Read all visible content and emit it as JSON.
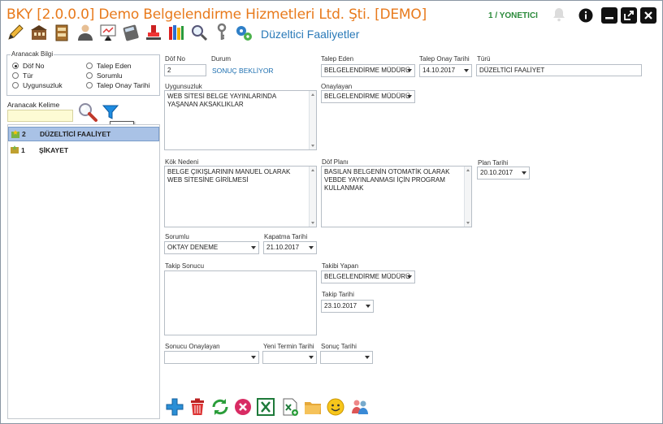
{
  "titlebar": {
    "app_title": "BKY [2.0.0.0] Demo Belgelendirme Hizmetleri Ltd. Şti. [DEMO]",
    "user": "1 / YONETICI",
    "module_title": "Düzeltici Faaliyetler"
  },
  "toolbar_icons": [
    "pencil-icon",
    "building-icon",
    "archive-icon",
    "user-icon",
    "presentation-icon",
    "calculator-icon",
    "stamp-icon",
    "books-icon",
    "magnifier-icon",
    "key-icon",
    "gears-icon"
  ],
  "left": {
    "group_title": "Aranacak Bilgi",
    "radios": [
      {
        "label": "Döf No",
        "checked": true
      },
      {
        "label": "Tür",
        "checked": false
      },
      {
        "label": "Uygunsuzluk",
        "checked": false
      },
      {
        "label": "Talep Eden",
        "checked": false
      },
      {
        "label": "Sorumlu",
        "checked": false
      },
      {
        "label": "Talep Onay Tarihi",
        "checked": false
      }
    ],
    "search_label": "Aranacak Kelime",
    "search_value": "",
    "tooltip": "Süz...",
    "list": [
      {
        "no": "2",
        "name": "DÜZELTİCİ FAALİYET",
        "selected": true
      },
      {
        "no": "1",
        "name": "ŞİKAYET",
        "selected": false
      }
    ]
  },
  "form": {
    "dof_no_label": "Döf No",
    "dof_no": "2",
    "durum_label": "Durum",
    "durum": "SONUÇ BEKLİYOR",
    "talep_eden_label": "Talep Eden",
    "talep_eden": "BELGELENDİRME MÜDÜRÜ",
    "talep_onay_label": "Talep Onay Tarihi",
    "talep_onay": "14.10.2017",
    "turu_label": "Türü",
    "turu": "DÜZELTİCİ FAALİYET",
    "uygunsuzluk_label": "Uygunsuzluk",
    "uygunsuzluk": "WEB SİTESİ BELGE YAYINLARINDA YAŞANAN AKSAKLIKLAR",
    "onaylayan_label": "Onaylayan",
    "onaylayan": "BELGELENDİRME MÜDÜRÜ",
    "kok_neden_label": "Kök Nedeni",
    "kok_neden": "BELGE ÇIKIŞLARININ MANUEL OLARAK WEB SİTESİNE GİRİLMESİ",
    "dof_plani_label": "Döf Planı",
    "dof_plani": "BASILAN BELGENİN OTOMATİK OLARAK VEBDE YAYINLANMASI İÇİN PROGRAM KULLANMAK",
    "plan_tarihi_label": "Plan Tarihi",
    "plan_tarihi": "20.10.2017",
    "sorumlu_label": "Sorumlu",
    "sorumlu": "OKTAY DENEME",
    "kapatma_label": "Kapatma Tarihi",
    "kapatma": "21.10.2017",
    "takip_sonucu_label": "Takip Sonucu",
    "takip_sonucu": "",
    "takibi_yapan_label": "Takibi Yapan",
    "takibi_yapan": "BELGELENDİRME MÜDÜRÜ",
    "takip_tarihi_label": "Takip Tarihi",
    "takip_tarihi": "23.10.2017",
    "sonucu_onaylayan_label": "Sonucu Onaylayan",
    "sonucu_onaylayan": "",
    "yeni_termin_label": "Yeni Termin Tarihi",
    "yeni_termin": "",
    "sonuc_tarihi_label": "Sonuç Tarihi",
    "sonuc_tarihi": ""
  },
  "bottom_icons": [
    "add-icon",
    "delete-icon",
    "refresh-icon",
    "cancel-icon",
    "excel-icon",
    "excel-export-icon",
    "folder-icon",
    "smiley-icon",
    "users-icon"
  ],
  "colors": {
    "title": "#e87a1c",
    "user": "#2a8a3a",
    "module": "#2a7ab8",
    "selected_row": "#a9c2e6"
  }
}
